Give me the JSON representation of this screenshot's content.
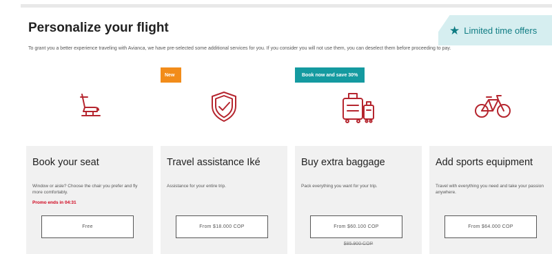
{
  "header": {
    "title": "Personalize your flight",
    "offer_label": "Limited time offers",
    "offer_icon": "star-icon",
    "intro": "To grant you a better experience traveling with Avianca, we have pre-selected some additional services for you. If you consider you will not use them, you can deselect them before proceeding to pay."
  },
  "colors": {
    "accent_red": "#b5252e",
    "teal": "#149aa0",
    "orange": "#f28c1a",
    "promo_red": "#d0021b"
  },
  "cards": [
    {
      "icon": "seat-icon",
      "badge": "",
      "title": "Book your seat",
      "description": "Window or aisle? Choose the chair you prefer and fly more comfortably.",
      "promo": "Promo ends in 04:31",
      "button_label": "Free",
      "old_price": ""
    },
    {
      "icon": "shield-check-icon",
      "badge": "New",
      "title": "Travel assistance Iké",
      "description": "Assistance for your entire trip.",
      "promo": "",
      "button_label": "From $18.000 COP",
      "old_price": ""
    },
    {
      "icon": "luggage-icon",
      "badge": "Book now and save 30%",
      "title": "Buy extra baggage",
      "description": "Pack everything you want for your trip.",
      "promo": "",
      "button_label": "From $60.100 COP",
      "old_price": "$85.900 COP"
    },
    {
      "icon": "bicycle-icon",
      "badge": "",
      "title": "Add sports equipment",
      "description": "Travel with everything you need and take your passion anywhere.",
      "promo": "",
      "button_label": "From $64.000 COP",
      "old_price": ""
    }
  ]
}
